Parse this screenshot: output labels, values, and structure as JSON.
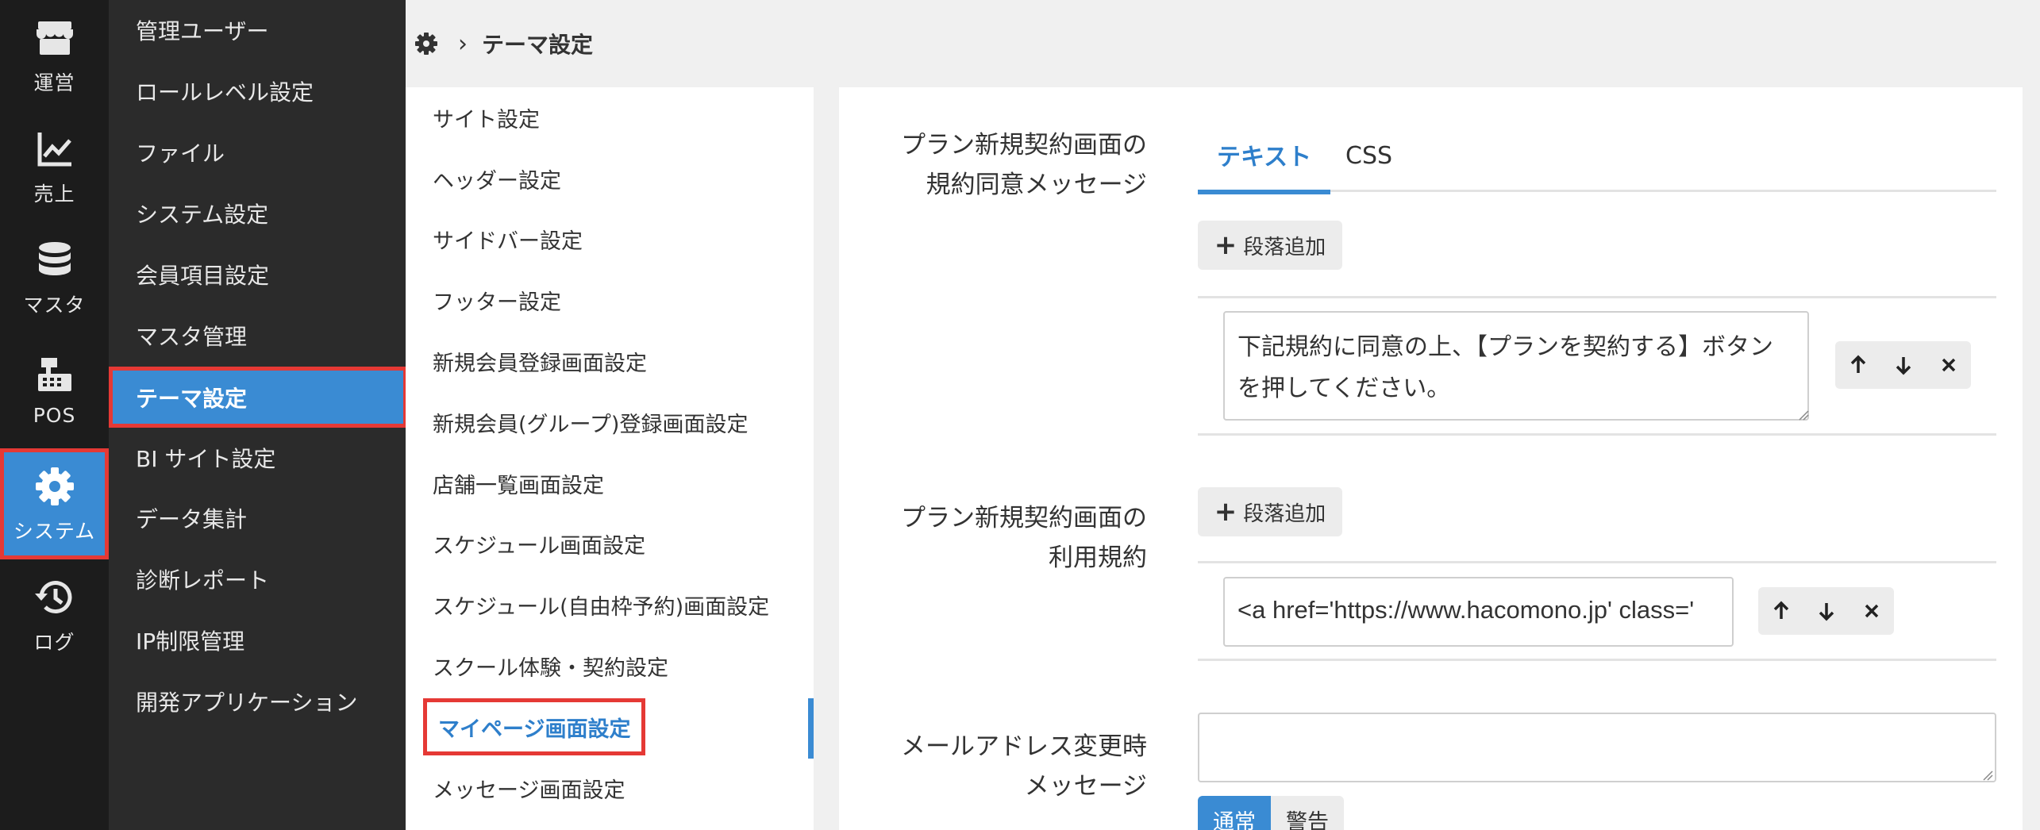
{
  "rail": {
    "items": [
      {
        "label": "運営",
        "icon": "store-icon"
      },
      {
        "label": "売上",
        "icon": "chart-line-icon"
      },
      {
        "label": "マスタ",
        "icon": "database-icon"
      },
      {
        "label": "POS",
        "icon": "cash-register-icon"
      },
      {
        "label": "システム",
        "icon": "gear-icon",
        "active": true
      },
      {
        "label": "ログ",
        "icon": "history-icon"
      }
    ]
  },
  "submenu": {
    "items": [
      {
        "label": "管理ユーザー"
      },
      {
        "label": "ロールレベル設定"
      },
      {
        "label": "ファイル"
      },
      {
        "label": "システム設定"
      },
      {
        "label": "会員項目設定"
      },
      {
        "label": "マスタ管理"
      },
      {
        "label": "テーマ設定",
        "active": true
      },
      {
        "label": "BI サイト設定"
      },
      {
        "label": "データ集計"
      },
      {
        "label": "診断レポート"
      },
      {
        "label": "IP制限管理"
      },
      {
        "label": "開発アプリケーション"
      }
    ]
  },
  "breadcrumb": {
    "icon": "gear-icon",
    "separator": "›",
    "title": "テーマ設定"
  },
  "theme_menu": {
    "items": [
      {
        "label": "サイト設定"
      },
      {
        "label": "ヘッダー設定"
      },
      {
        "label": "サイドバー設定"
      },
      {
        "label": "フッター設定"
      },
      {
        "label": "新規会員登録画面設定"
      },
      {
        "label": "新規会員(グループ)登録画面設定"
      },
      {
        "label": "店舗一覧画面設定"
      },
      {
        "label": "スケジュール画面設定"
      },
      {
        "label": "スケジュール(自由枠予約)画面設定"
      },
      {
        "label": "スクール体験・契約設定"
      },
      {
        "label": "マイページ画面設定",
        "active": true
      },
      {
        "label": "メッセージ画面設定"
      }
    ]
  },
  "main": {
    "section1": {
      "label_line1": "プラン新規契約画面の",
      "label_line2": "規約同意メッセージ",
      "tabs": [
        {
          "label": "テキスト",
          "active": true
        },
        {
          "label": "CSS"
        }
      ],
      "add_button": "段落追加",
      "paragraph_text": "下記規約に同意の上、【プランを契約する】ボタンを押してください。"
    },
    "section2": {
      "label_line1": "プラン新規契約画面の",
      "label_line2": "利用規約",
      "add_button": "段落追加",
      "input_value": "<a href='https://www.hacomono.jp' class='"
    },
    "section3": {
      "label_line1": "メールアドレス変更時",
      "label_line2": "メッセージ",
      "textarea_value": "",
      "segment_options": [
        {
          "label": "通常",
          "active": true
        },
        {
          "label": "警告"
        }
      ]
    }
  },
  "colors": {
    "accent": "#3a8bd3",
    "highlight": "#e53935",
    "rail_bg": "#1c1c1c",
    "submenu_bg": "#2b2b2b"
  }
}
